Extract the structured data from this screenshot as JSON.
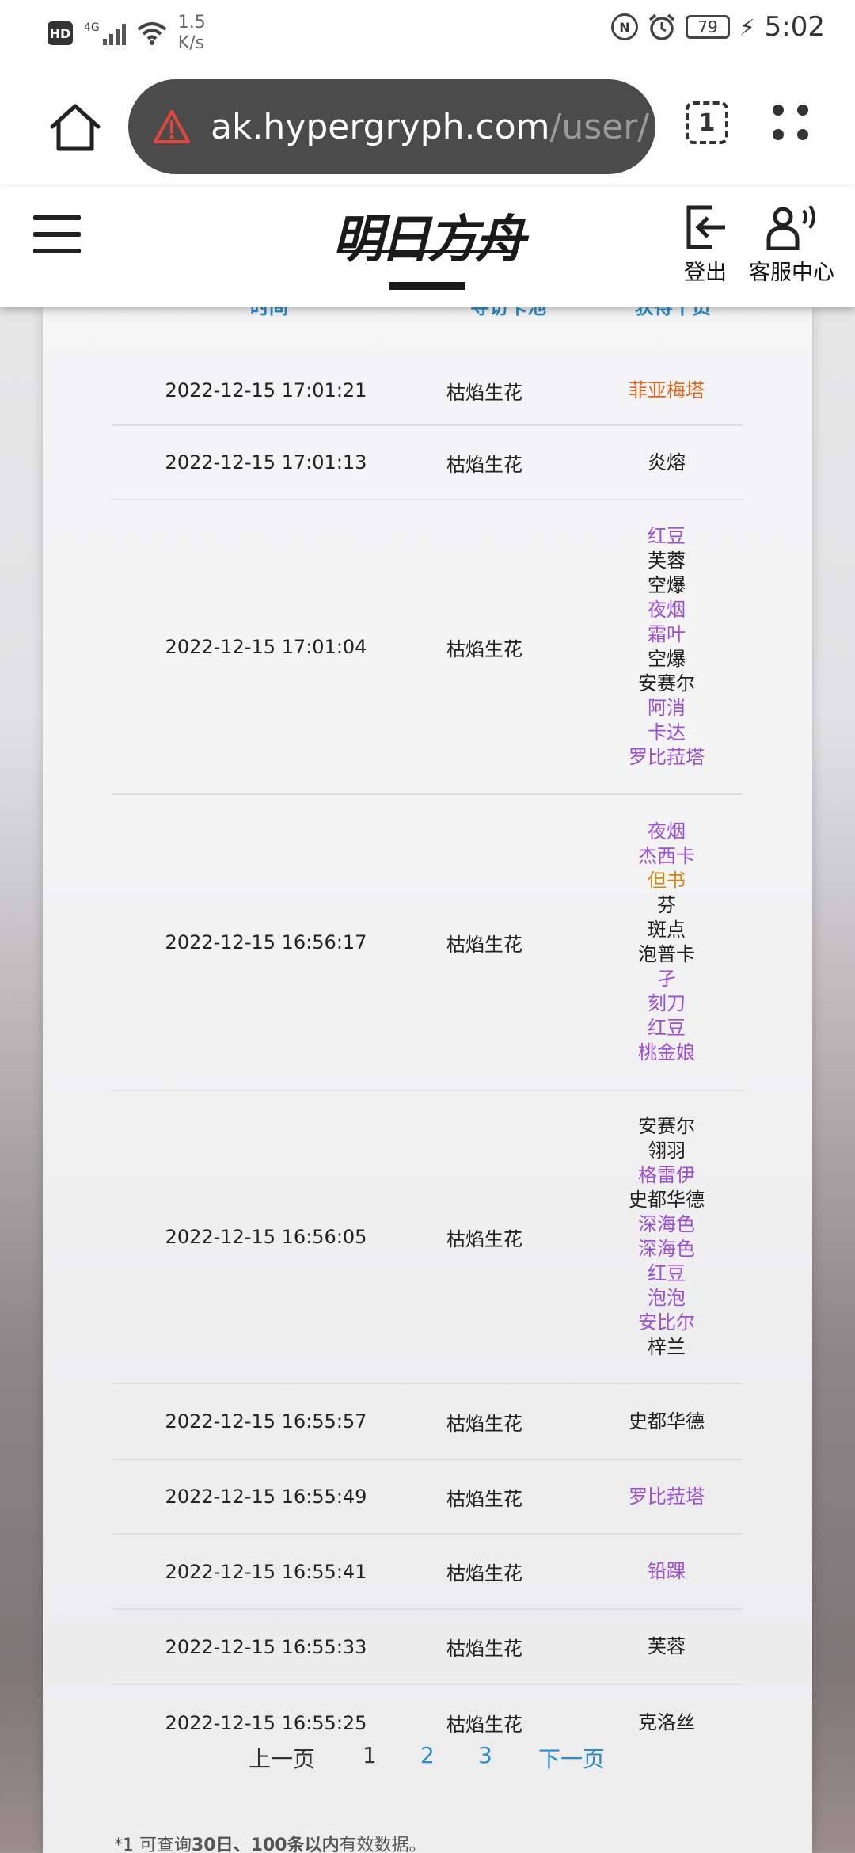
{
  "status_bar": {
    "hd": "HD",
    "network": "4G",
    "speed_value": "1.5",
    "speed_unit": "K/s",
    "battery": "79",
    "time": "5:02"
  },
  "browser": {
    "url_host": "ak.hypergryph.com",
    "url_path": "/user/",
    "tab_count": "1"
  },
  "site_header": {
    "logo_text": "明日方舟",
    "logout_label": "登出",
    "service_label": "客服中心"
  },
  "table": {
    "headers": [
      "时间",
      "寻访卡池",
      "获得干员"
    ],
    "rows": [
      {
        "time": "2022-12-15 17:01:21",
        "pool": "枯焰生花",
        "operators": [
          {
            "name": "菲亚梅塔",
            "rarity": 6
          }
        ]
      },
      {
        "time": "2022-12-15 17:01:13",
        "pool": "枯焰生花",
        "operators": [
          {
            "name": "炎熔",
            "rarity": 3
          }
        ]
      },
      {
        "time": "2022-12-15 17:01:04",
        "pool": "枯焰生花",
        "operators": [
          {
            "name": "红豆",
            "rarity": 4
          },
          {
            "name": "芙蓉",
            "rarity": 3
          },
          {
            "name": "空爆",
            "rarity": 3
          },
          {
            "name": "夜烟",
            "rarity": 4
          },
          {
            "name": "霜叶",
            "rarity": 4
          },
          {
            "name": "空爆",
            "rarity": 3
          },
          {
            "name": "安赛尔",
            "rarity": 3
          },
          {
            "name": "阿消",
            "rarity": 4
          },
          {
            "name": "卡达",
            "rarity": 4
          },
          {
            "name": "罗比菈塔",
            "rarity": 4
          }
        ]
      },
      {
        "time": "2022-12-15 16:56:17",
        "pool": "枯焰生花",
        "operators": [
          {
            "name": "夜烟",
            "rarity": 4
          },
          {
            "name": "杰西卡",
            "rarity": 4
          },
          {
            "name": "但书",
            "rarity": 5
          },
          {
            "name": "芬",
            "rarity": 3
          },
          {
            "name": "斑点",
            "rarity": 3
          },
          {
            "name": "泡普卡",
            "rarity": 3
          },
          {
            "name": "孑",
            "rarity": 4
          },
          {
            "name": "刻刀",
            "rarity": 4
          },
          {
            "name": "红豆",
            "rarity": 4
          },
          {
            "name": "桃金娘",
            "rarity": 4
          }
        ]
      },
      {
        "time": "2022-12-15 16:56:05",
        "pool": "枯焰生花",
        "operators": [
          {
            "name": "安赛尔",
            "rarity": 3
          },
          {
            "name": "翎羽",
            "rarity": 3
          },
          {
            "name": "格雷伊",
            "rarity": 4
          },
          {
            "name": "史都华德",
            "rarity": 3
          },
          {
            "name": "深海色",
            "rarity": 4
          },
          {
            "name": "深海色",
            "rarity": 4
          },
          {
            "name": "红豆",
            "rarity": 4
          },
          {
            "name": "泡泡",
            "rarity": 4
          },
          {
            "name": "安比尔",
            "rarity": 4
          },
          {
            "name": "梓兰",
            "rarity": 3
          }
        ]
      },
      {
        "time": "2022-12-15 16:55:57",
        "pool": "枯焰生花",
        "operators": [
          {
            "name": "史都华德",
            "rarity": 3
          }
        ]
      },
      {
        "time": "2022-12-15 16:55:49",
        "pool": "枯焰生花",
        "operators": [
          {
            "name": "罗比菈塔",
            "rarity": 4
          }
        ]
      },
      {
        "time": "2022-12-15 16:55:41",
        "pool": "枯焰生花",
        "operators": [
          {
            "name": "铅踝",
            "rarity": 4
          }
        ]
      },
      {
        "time": "2022-12-15 16:55:33",
        "pool": "枯焰生花",
        "operators": [
          {
            "name": "芙蓉",
            "rarity": 3
          }
        ]
      },
      {
        "time": "2022-12-15 16:55:25",
        "pool": "枯焰生花",
        "operators": [
          {
            "name": "克洛丝",
            "rarity": 3
          }
        ]
      }
    ]
  },
  "pagination": {
    "prev": "上一页",
    "pages": [
      "1",
      "2",
      "3"
    ],
    "current": "1",
    "next": "下一页"
  },
  "note": {
    "prefix": "*1 可查询",
    "days": "30日",
    "sep": "、",
    "count": "100条以内",
    "suffix": "有效数据。"
  },
  "colors": {
    "header_blue": "#2a8dc7",
    "rarity3": "#1f1f1f",
    "rarity4": "#9b4fd1",
    "rarity5": "#c98a16",
    "rarity6": "#e0671c"
  }
}
